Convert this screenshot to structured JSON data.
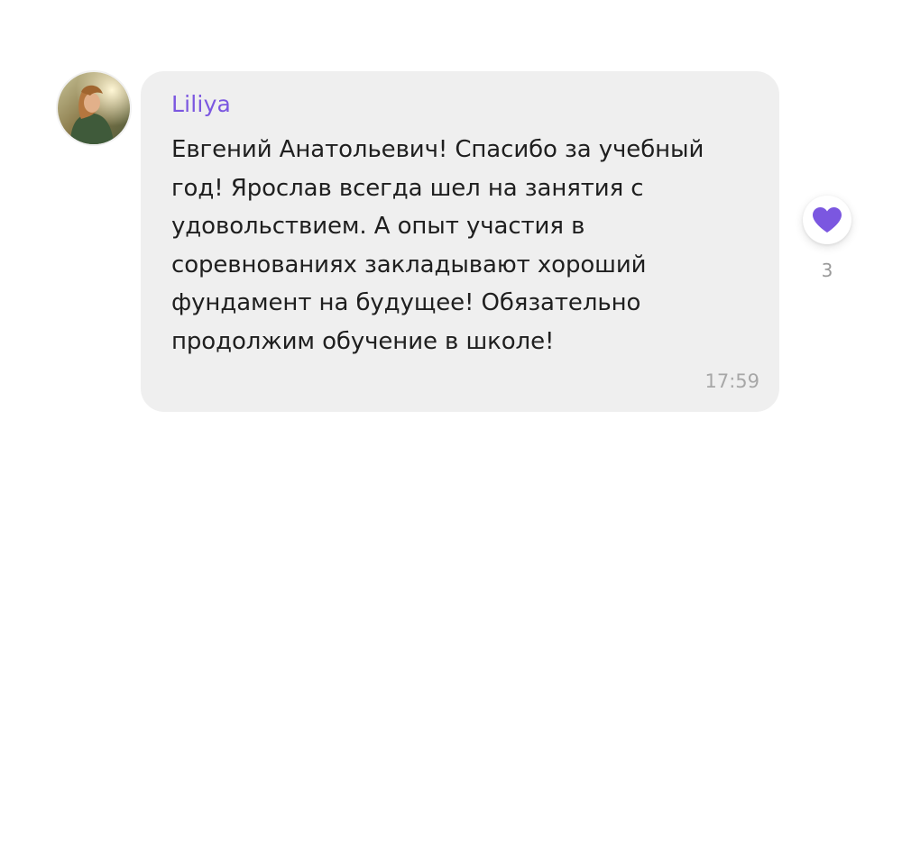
{
  "message": {
    "author": "Liliya",
    "text": "Евгений Анатольевич! Спасибо за учебный год! Ярослав всегда шел на занятия с удовольствием. А опыт участия в соревнованиях закладывают хороший фундамент на будущее! Обязательно продолжим обучение в школе!",
    "time": "17:59"
  },
  "reaction": {
    "icon": "heart-icon",
    "count": "3",
    "color": "#7b57e0"
  },
  "colors": {
    "author": "#7b57e0",
    "bubble": "#efefef",
    "text": "#1f1f1f",
    "time": "#a7a7a7"
  }
}
